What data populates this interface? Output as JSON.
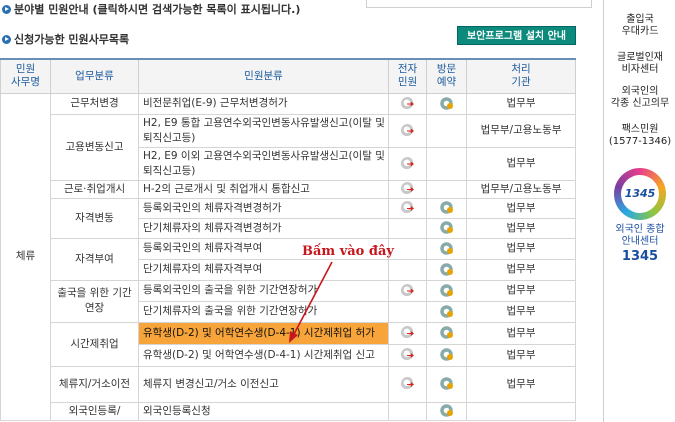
{
  "sections": {
    "by_category": "분야별 민원안내 (클릭하시면 검색가능한 목록이 표시됩니다.)",
    "applicable_list": "신청가능한 민원사무목록",
    "security_button": "보안프로그램 설치 안내"
  },
  "table": {
    "headers": {
      "service_name": "민원\n사무명",
      "category": "업무분류",
      "complaint": "민원분류",
      "electronic": "전자\n민원",
      "visit": "방문\n예약",
      "agency": "처리\n기관"
    },
    "stay_label": "체류",
    "groups": {
      "g1": "근무처변경",
      "g2": "고용변동신고",
      "g3": "근로·취업개시",
      "g4": "자격변동",
      "g5": "자격부여",
      "g6": "출국을 위한 기간연장",
      "g7": "시간제취업",
      "g8": "체류지/거소이전",
      "g9": "외국인등록/"
    },
    "rows": {
      "r1": {
        "name": "비전문취업(E-9) 근무처변경허가",
        "agency": "법무부"
      },
      "r2": {
        "name": "H2, E9 통합 고용연수외국인변동사유발생신고(이탈 및 퇴직신고등)",
        "agency": "법무부/고용노동부"
      },
      "r3": {
        "name": "H2, E9 이외 고용연수외국인변동사유발생신고(이탈 및 퇴직신고등)",
        "agency": "법무부"
      },
      "r4": {
        "name": "H-2의 근로개시 및 취업개시 통합신고",
        "agency": "법무부/고용노동부"
      },
      "r5": {
        "name": "등록외국인의 체류자격변경허가",
        "agency": "법무부"
      },
      "r6": {
        "name": "단기체류자의 체류자격변경허가",
        "agency": "법무부"
      },
      "r7": {
        "name": "등록외국인의 체류자격부여",
        "agency": "법무부"
      },
      "r8": {
        "name": "단기체류자의 체류자격부여",
        "agency": "법무부"
      },
      "r9": {
        "name": "등록외국인의 출국을 위한 기간연장허가",
        "agency": "법무부"
      },
      "r10": {
        "name": "단기체류자의 출국을 위한 기간연장허가",
        "agency": "법무부"
      },
      "r11": {
        "name": "유학생(D-2) 및 어학연수생(D-4-1) 시간제취업 허가",
        "agency": "법무부"
      },
      "r12": {
        "name": "유학생(D-2) 및 어학연수생(D-4-1) 시간제취업 신고",
        "agency": "법무부"
      },
      "r13": {
        "name": "체류지 변경신고/거소 이전신고",
        "agency": "법무부"
      },
      "r14": {
        "name": "외국인등록신청",
        "agency": ""
      }
    }
  },
  "sidebar": {
    "s1": "출입국\n우대카드",
    "s2": "글로벌인재\n비자센터",
    "s3": "외국인의\n각종 신고의무",
    "s4": "팩스민원\n(1577-1346)",
    "logo": "1345",
    "s5": "외국인 종합\n안내센터",
    "s6": "1345"
  },
  "annotation": "Bấm vào đây",
  "colors": {
    "highlight": "#f7a43a",
    "header_text": "#1c5a9c",
    "button": "#0c8a7c",
    "annotation": "#c8161d"
  }
}
